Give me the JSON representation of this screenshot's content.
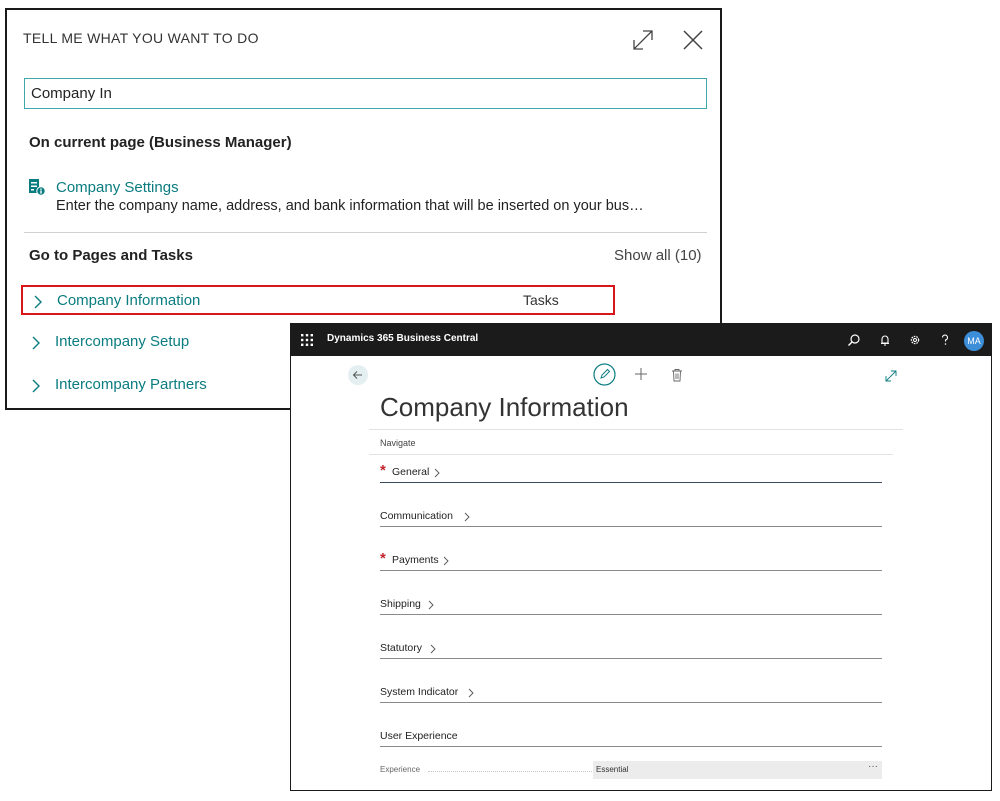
{
  "tellme": {
    "title": "TELL ME WHAT YOU WANT TO DO",
    "search_value": "Company In",
    "current_page_heading": "On current page (Business Manager)",
    "result": {
      "title": "Company Settings",
      "description": "Enter the company name, address, and bank information that will be inserted on your bus…"
    },
    "pages_heading": "Go to Pages and Tasks",
    "show_all": "Show all (10)",
    "items": [
      {
        "label": "Company Information",
        "category": "Tasks"
      },
      {
        "label": "Intercompany Setup"
      },
      {
        "label": "Intercompany Partners"
      }
    ]
  },
  "bc": {
    "app_name": "Dynamics 365 Business Central",
    "avatar": "MA",
    "page_title": "Company Information",
    "navigate": "Navigate",
    "fasttabs": [
      {
        "label": "General",
        "required": true
      },
      {
        "label": "Communication",
        "required": false
      },
      {
        "label": "Payments",
        "required": true
      },
      {
        "label": "Shipping",
        "required": false
      },
      {
        "label": "Statutory",
        "required": false
      },
      {
        "label": "System Indicator",
        "required": false
      },
      {
        "label": "User Experience",
        "required": false
      }
    ],
    "field": {
      "label": "Experience",
      "value": "Essential",
      "more": "···"
    }
  },
  "colors": {
    "accent": "#0a7c80",
    "highlight": "#d9171b",
    "required": "#c4262e",
    "topbar": "#1b1b1b"
  }
}
